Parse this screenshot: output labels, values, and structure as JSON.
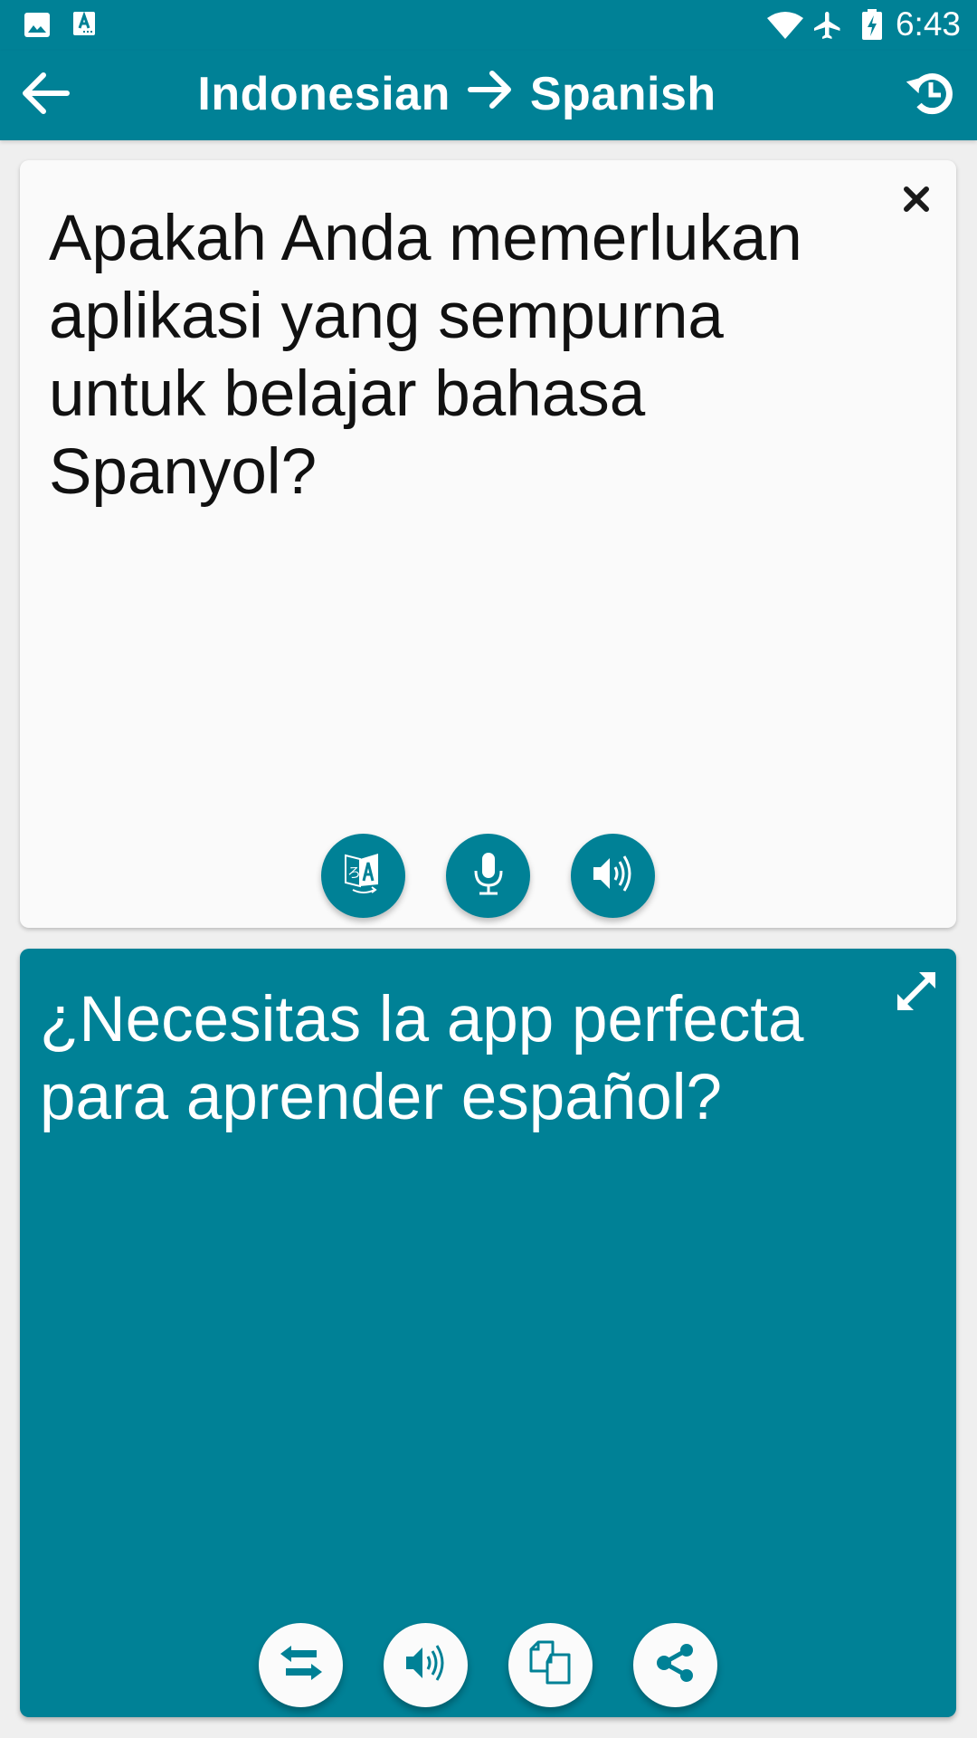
{
  "status_bar": {
    "time": "6:43",
    "left_icons": [
      "image-notification-icon",
      "translate-notification-icon"
    ],
    "right_icons": [
      "wifi-icon",
      "airplane-mode-icon",
      "battery-charging-icon"
    ]
  },
  "app_bar": {
    "source_language": "Indonesian",
    "target_language": "Spanish",
    "back_icon": "arrow-left-icon",
    "direction_icon": "arrow-right-icon",
    "history_icon": "history-icon"
  },
  "input_card": {
    "text": "Apakah Anda memerlukan aplikasi yang sempurna untuk belajar bahasa Spanyol?",
    "clear_icon": "close-icon",
    "actions": [
      {
        "name": "translate-button",
        "icon": "translate-icon"
      },
      {
        "name": "microphone-button",
        "icon": "microphone-icon"
      },
      {
        "name": "speak-input-button",
        "icon": "speaker-icon"
      }
    ]
  },
  "output_card": {
    "text": "¿Necesitas la app perfecta para aprender español?",
    "expand_icon": "expand-icon",
    "actions": [
      {
        "name": "swap-languages-button",
        "icon": "swap-icon"
      },
      {
        "name": "speak-output-button",
        "icon": "speaker-icon"
      },
      {
        "name": "copy-button",
        "icon": "copy-icon"
      },
      {
        "name": "share-button",
        "icon": "share-icon"
      }
    ]
  },
  "colors": {
    "primary": "#008196",
    "input_card_bg": "#fafafa",
    "background": "#efefef",
    "text_dark": "#111111",
    "text_light": "#ffffff"
  }
}
